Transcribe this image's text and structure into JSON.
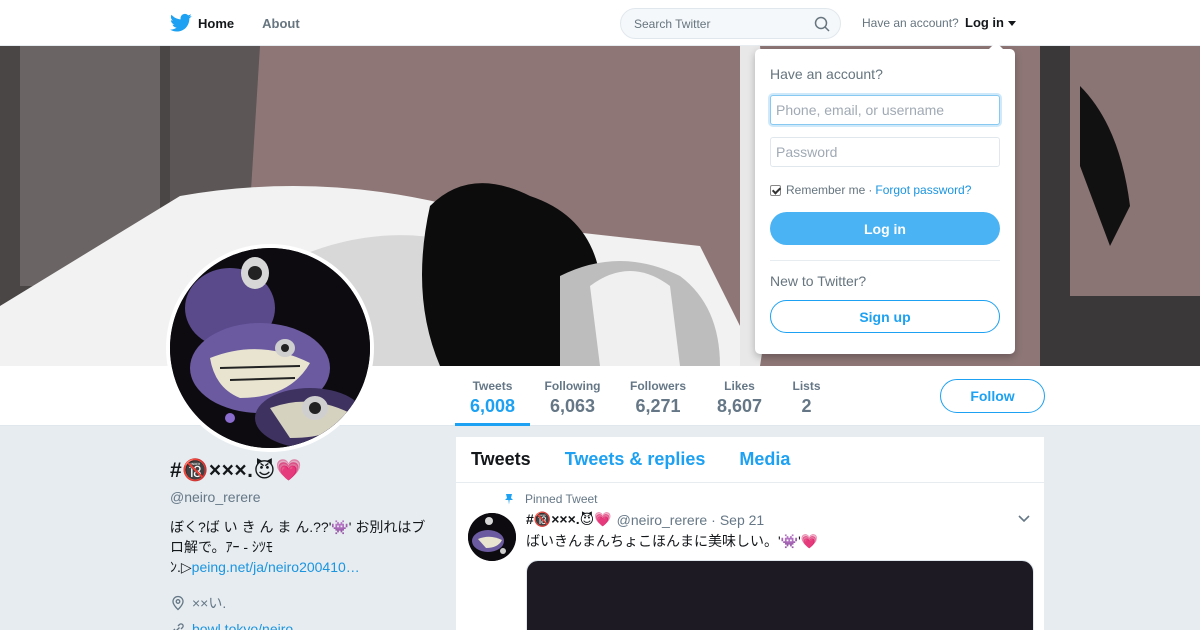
{
  "topbar": {
    "home_label": "Home",
    "about_label": "About",
    "search_placeholder": "Search Twitter",
    "have_account": "Have an account?",
    "login_label": "Log in"
  },
  "stats": {
    "tweets_label": "Tweets",
    "tweets_value": "6,008",
    "following_label": "Following",
    "following_value": "6,063",
    "followers_label": "Followers",
    "followers_value": "6,271",
    "likes_label": "Likes",
    "likes_value": "8,607",
    "lists_label": "Lists",
    "lists_value": "2",
    "follow_label": "Follow"
  },
  "profile": {
    "name": "#🔞×××.😈💗",
    "handle": "@neiro_rerere",
    "bio_text": "ぼく?ば い き ん ま ん.??'👾' お別れはブロ解で。ｱｰ - ｼﾂﾓ ﾝ.▷",
    "bio_link": "peing.net/ja/neiro200410…",
    "location": "××い.",
    "website": "bowl.tokyo/neiro…"
  },
  "timeline": {
    "tab_tweets": "Tweets",
    "tab_replies": "Tweets & replies",
    "tab_media": "Media"
  },
  "tweet": {
    "pinned_label": "Pinned Tweet",
    "name": "#🔞×××.😈💗",
    "handle": "@neiro_rerere",
    "dot": "·",
    "date": "Sep 21",
    "text": "ばいきんまんちょこほんまに美味しい。'👾'💗"
  },
  "login_dropdown": {
    "title": "Have an account?",
    "username_placeholder": "Phone, email, or username",
    "password_placeholder": "Password",
    "remember_label": "Remember me",
    "separator": "·",
    "forgot_label": "Forgot password?",
    "login_button": "Log in",
    "new_label": "New to Twitter?",
    "signup_button": "Sign up"
  },
  "colors": {
    "accent": "#1da1f2",
    "login_button": "#4ab3f4",
    "page_bg": "#e6ecf0"
  }
}
